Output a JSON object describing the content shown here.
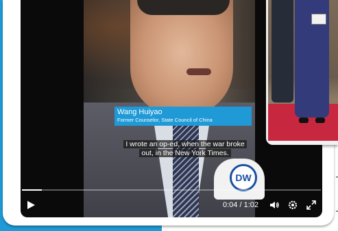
{
  "video": {
    "lower_third": {
      "name": "Wang Huiyao",
      "role": "Former Counselor, State Council of China"
    },
    "subtitle": {
      "line1": "I wrote an op-ed, when the war broke",
      "line2": "out, in the New York Times."
    },
    "logo_text": "DW",
    "progress_fraction": 0.066,
    "time_display": "0:04 / 1:02",
    "controls": {
      "play_icon": "play-icon",
      "volume_icon": "volume-icon",
      "settings_icon": "gear-icon",
      "fullscreen_icon": "fullscreen-icon"
    }
  },
  "colors": {
    "accent_blue": "#1f9ad6",
    "dw_blue": "#1a4fa0",
    "carpet_red": "#c8283f"
  }
}
